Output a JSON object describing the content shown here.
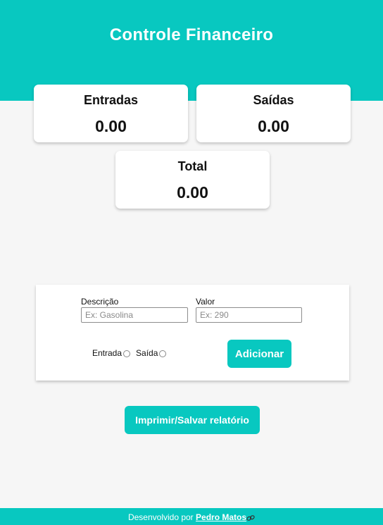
{
  "header": {
    "title": "Controle Financeiro"
  },
  "summary": {
    "entradas": {
      "label": "Entradas",
      "value": "0.00"
    },
    "saidas": {
      "label": "Saídas",
      "value": "0.00"
    },
    "total": {
      "label": "Total",
      "value": "0.00"
    }
  },
  "form": {
    "descricao": {
      "label": "Descrição",
      "placeholder": "Ex: Gasolina",
      "value": ""
    },
    "valor": {
      "label": "Valor",
      "placeholder": "Ex: 290",
      "value": ""
    },
    "radio_entrada": "Entrada",
    "radio_saida": "Saída",
    "add_button": "Adicionar"
  },
  "print_button": "Imprimir/Salvar relatório",
  "footer": {
    "prefix": "Desenvolvido por",
    "author": "Pedro Matos",
    "link_icon": "link-icon"
  },
  "colors": {
    "accent": "#08c8c0",
    "background": "#f6f6f6",
    "card": "#ffffff"
  }
}
